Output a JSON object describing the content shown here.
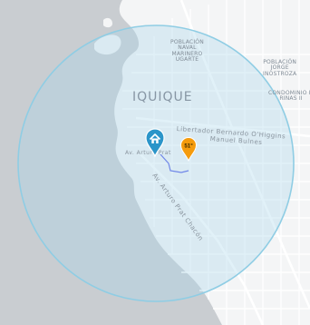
{
  "map": {
    "colors": {
      "water": "#c9cdd1",
      "land": "#f4f5f6",
      "roads": "#ffffff",
      "radius_fill": "#a8d8ea",
      "radius_stroke": "#8fcde4",
      "pin_home": "#2b95c9",
      "pin_price": "#f59b0c",
      "route": "#6f86e8"
    },
    "labels": {
      "city": "IQUIQUE",
      "poblacion_naval": "POBLACIÓN\nNAVAL\nMARINERO\nUGARTE",
      "poblacion_jorge": "POBLACIÓN\nJORGE\nINOSTROZA",
      "condominio": "CONDOMINIO M\nRINAS II",
      "street_ohiggins": "Libertador Bernardo O'Higgins",
      "street_bulnes": "Manuel Bulnes",
      "street_arturo": "Av. Arturo Prat Chacón",
      "street_short": "Av. Arturo Prat"
    },
    "markers": {
      "home_icon": "house-icon",
      "price_label": "51°"
    }
  }
}
